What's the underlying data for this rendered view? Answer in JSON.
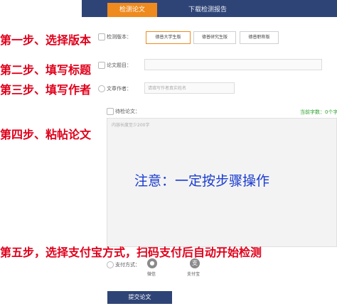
{
  "tabs": {
    "detect": "检测论文",
    "report": "下载检测报告"
  },
  "steps": {
    "s1": "第一步、选择版本",
    "s2": "第二步、填写标题",
    "s3": "第三步、填写作者",
    "s4": "第四步、粘帖论文",
    "s5": "第五步，选择支付宝方式，扫码支付后自动开始检测"
  },
  "form": {
    "version_label": "检测版本：",
    "versions": [
      "德普大学生版",
      "德普研究生版",
      "德普职称版"
    ],
    "selected_version": "德普大学生版",
    "title_label": "论文题目：",
    "title_value": "",
    "author_label": "文章作者：",
    "author_placeholder": "请填写作者真实姓名",
    "content_label": "待检论文：",
    "count_text": "当前字数：0个字",
    "content_placeholder": "内容长度至少200字",
    "note": "注意：一定按步骤操作",
    "payment_label": "支付方式：",
    "payment_methods": {
      "wechat": "微信",
      "alipay": "支付宝"
    },
    "submit": "提交论文"
  },
  "colors": {
    "nav": "#2f4476",
    "accent": "#ee8a1e",
    "step_text": "#e0001b",
    "note": "#1a3ccf",
    "count": "#2aa02a"
  }
}
